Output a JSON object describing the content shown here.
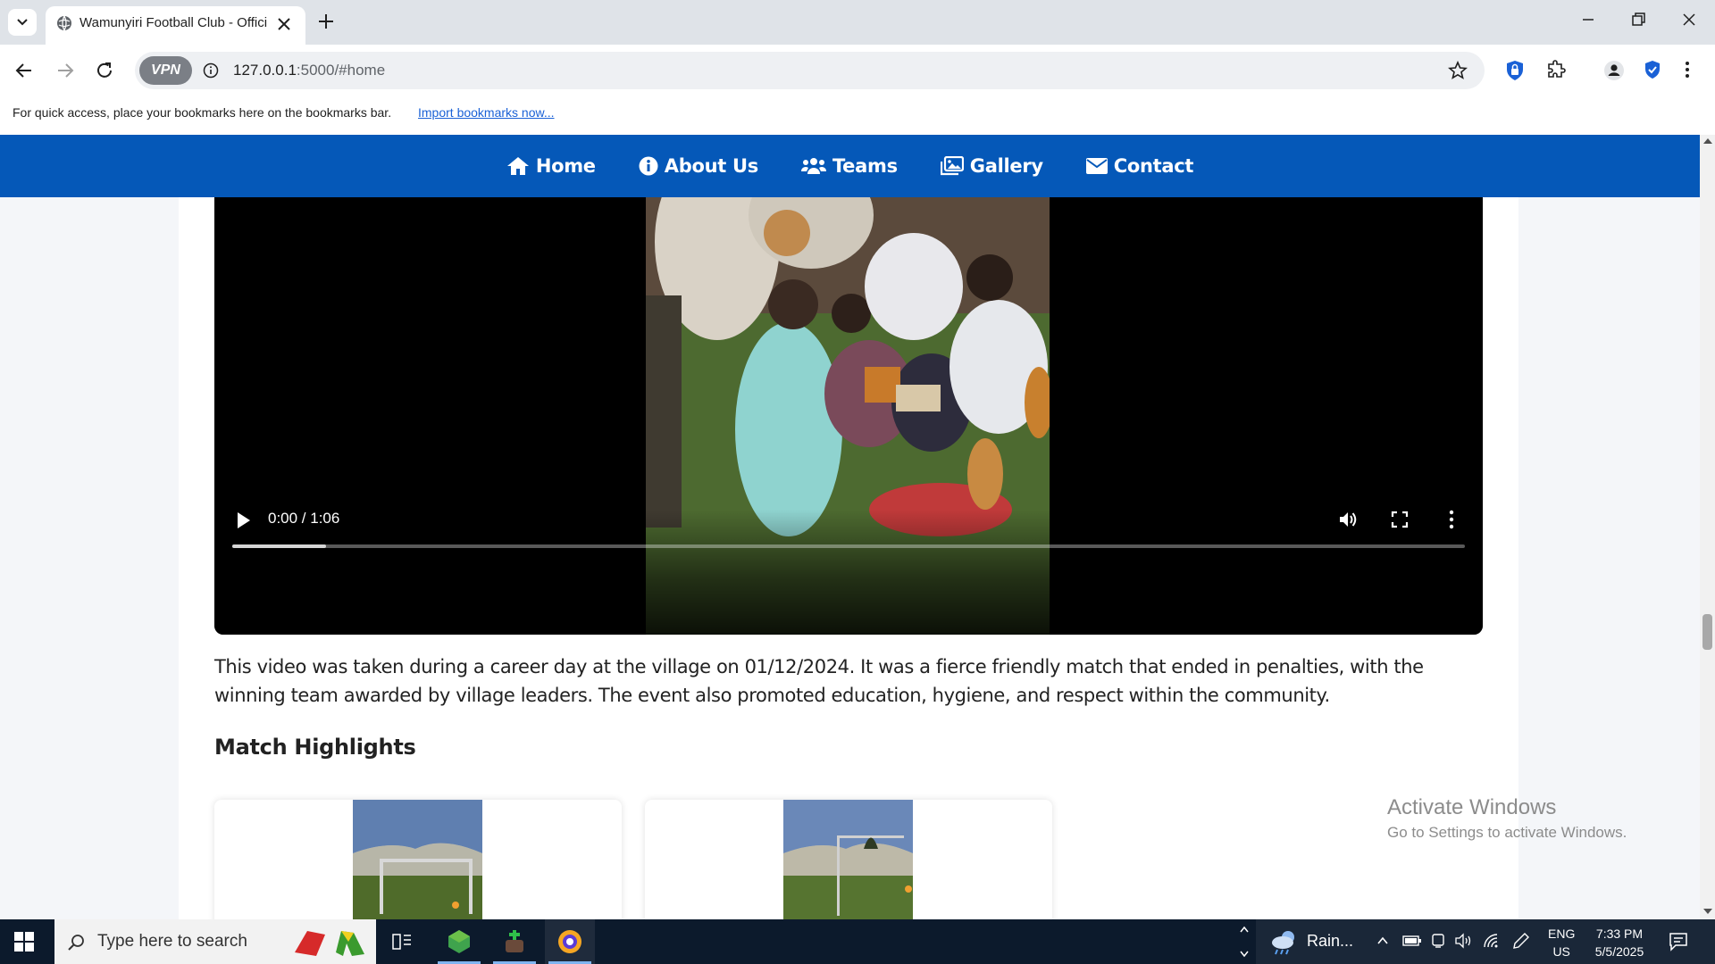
{
  "browser": {
    "tab_title": "Wamunyiri Football Club - Official",
    "url_host": "127.0.0.1",
    "url_path": ":5000/#home",
    "vpn_label": "VPN",
    "bookmarks_hint": "For quick access, place your bookmarks here on the bookmarks bar.",
    "import_bookmarks": "Import bookmarks now..."
  },
  "nav": {
    "items": [
      {
        "label": "Home",
        "icon": "home-icon"
      },
      {
        "label": "About Us",
        "icon": "info-icon"
      },
      {
        "label": "Teams",
        "icon": "users-icon"
      },
      {
        "label": "Gallery",
        "icon": "images-icon"
      },
      {
        "label": "Contact",
        "icon": "envelope-icon"
      }
    ]
  },
  "video": {
    "time": "0:00 / 1:06",
    "buffered_fraction": 0.076
  },
  "main": {
    "description": "This video was taken during a career day at the village on 01/12/2024. It was a fierce friendly match that ended in penalties, with the winning team awarded by village leaders. The event also promoted education, hygiene, and respect within the community.",
    "section_title": "Match Highlights"
  },
  "watermark": {
    "line1": "Activate Windows",
    "line2": "Go to Settings to activate Windows."
  },
  "taskbar": {
    "search_placeholder": "Type here to search",
    "weather": "Rain...",
    "lang_line1": "ENG",
    "lang_line2": "US",
    "time": "7:33 PM",
    "date": "5/5/2025"
  },
  "colors": {
    "nav_bg": "#0558b8",
    "taskbar_bg": "#0c1a2c",
    "link": "#1a61d6"
  }
}
